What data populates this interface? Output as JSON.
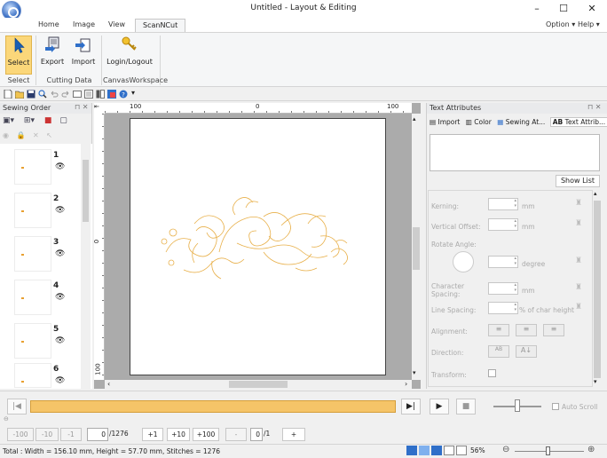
{
  "window": {
    "title": "Untitled - Layout & Editing",
    "minimize": "–",
    "maximize": "☐",
    "close": "✕"
  },
  "tabs": {
    "home": "Home",
    "image": "Image",
    "view": "View",
    "scancut": "ScanNCut",
    "option": "Option",
    "help": "Help"
  },
  "ribbon": {
    "select": "Select",
    "export": "Export",
    "import": "Import",
    "login": "Login/Logout",
    "group_select": "Select",
    "group_cutting": "Cutting Data",
    "group_canvas": "CanvasWorkspace"
  },
  "sewing_order": {
    "title": "Sewing Order",
    "items": [
      {
        "num": "1"
      },
      {
        "num": "2"
      },
      {
        "num": "3"
      },
      {
        "num": "4"
      },
      {
        "num": "5"
      },
      {
        "num": "6"
      }
    ]
  },
  "rulers": {
    "h100a": "100",
    "h0": "0",
    "h100b": "100",
    "v0": "0",
    "v100": "100"
  },
  "text_attributes": {
    "title": "Text Attributes",
    "tab_import": "Import",
    "tab_color": "Color",
    "tab_sewing": "Sewing At...",
    "tab_text": "Text Attrib...",
    "show_list": "Show List",
    "kerning": "Kerning:",
    "vertical_offset": "Vertical Offset:",
    "rotate_angle": "Rotate Angle:",
    "character_spacing": "Character Spacing:",
    "line_spacing": "Line Spacing:",
    "alignment": "Alignment:",
    "direction": "Direction:",
    "transform": "Transform:",
    "unit_mm": "mm",
    "unit_degree": "degree",
    "unit_line": "% of char height",
    "dir_ab": "AB",
    "dir_az": "A↓"
  },
  "playback": {
    "auto_scroll": "Auto Scroll"
  },
  "stepper": {
    "m100": "-100",
    "m10": "-10",
    "m1": "-1",
    "stitch_value": "0",
    "stitch_total": "/1276",
    "p1": "+1",
    "p10": "+10",
    "p100": "+100",
    "minus": "-",
    "pattern_value": "0",
    "pattern_total": "/1",
    "plus": "+"
  },
  "status": {
    "text": "Total : Width = 156.10 mm, Height = 57.70 mm, Stitches = 1276",
    "zoom": "56%"
  },
  "colors": {
    "accent_select": "#fbd77a",
    "progress": "#f5c468",
    "embroidery": "#e8b04a"
  }
}
